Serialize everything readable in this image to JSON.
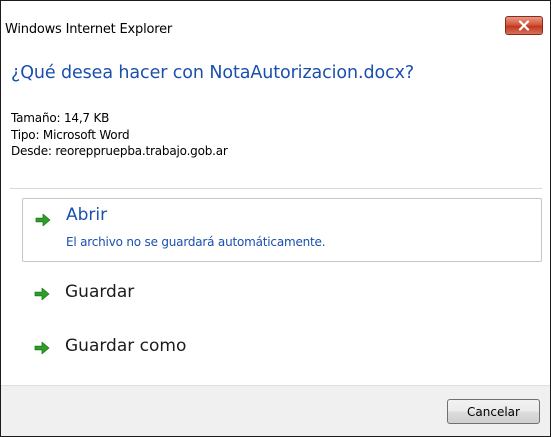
{
  "window": {
    "title": "Windows Internet Explorer"
  },
  "dialog": {
    "heading": "¿Qué desea hacer con NotaAutorizacion.docx?",
    "info": {
      "size": "Tamaño: 14,7 KB",
      "type": "Tipo: Microsoft Word",
      "from": "Desde: reoreppruepba.trabajo.gob.ar"
    },
    "options": [
      {
        "label": "Abrir",
        "sublabel": "El archivo no se guardará automáticamente.",
        "icon": "green-arrow-icon",
        "selected": true
      },
      {
        "label": "Guardar",
        "icon": "green-arrow-icon"
      },
      {
        "label": "Guardar como",
        "icon": "green-arrow-icon"
      }
    ],
    "cancel_label": "Cancelar"
  },
  "colors": {
    "link_blue": "#1a4fae",
    "arrow_green": "#2e9e2a",
    "close_red": "#c1391e"
  }
}
